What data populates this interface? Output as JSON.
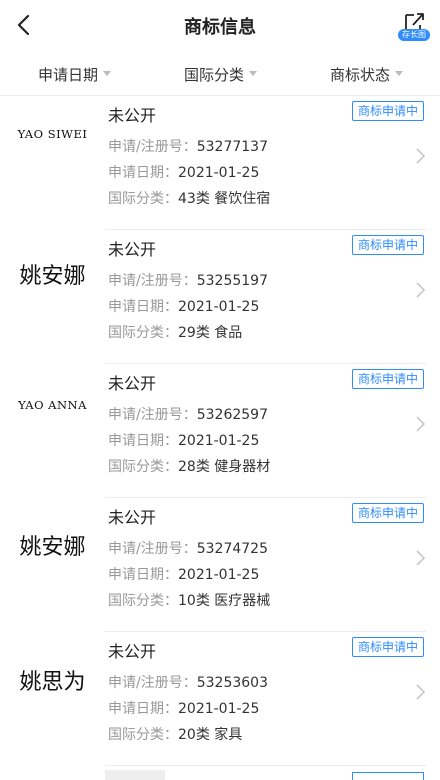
{
  "header": {
    "title": "商标信息",
    "share_badge": "存长图",
    "back_icon": "chevron-left-icon",
    "share_icon": "share-export-icon"
  },
  "filters": [
    {
      "label": "申请日期"
    },
    {
      "label": "国际分类"
    },
    {
      "label": "商标状态"
    }
  ],
  "labels": {
    "reg_no": "申请/注册号：",
    "apply_date": "申请日期：",
    "intl_class": "国际分类："
  },
  "colors": {
    "accent": "#2f8cff"
  },
  "items": [
    {
      "logo_text": "YAO SIWEI",
      "logo_style": "latin",
      "name": "未公开",
      "status": "商标申请中",
      "reg_no": "53277137",
      "apply_date": "2021-01-25",
      "intl_class": "43类 餐饮住宿"
    },
    {
      "logo_text": "姚安娜",
      "logo_style": "cjk",
      "name": "未公开",
      "status": "商标申请中",
      "reg_no": "53255197",
      "apply_date": "2021-01-25",
      "intl_class": "29类 食品"
    },
    {
      "logo_text": "YAO ANNA",
      "logo_style": "latin",
      "name": "未公开",
      "status": "商标申请中",
      "reg_no": "53262597",
      "apply_date": "2021-01-25",
      "intl_class": "28类 健身器材"
    },
    {
      "logo_text": "姚安娜",
      "logo_style": "cjk",
      "name": "未公开",
      "status": "商标申请中",
      "reg_no": "53274725",
      "apply_date": "2021-01-25",
      "intl_class": "10类 医疗器械"
    },
    {
      "logo_text": "姚思为",
      "logo_style": "cjk",
      "name": "未公开",
      "status": "商标申请中",
      "reg_no": "53253603",
      "apply_date": "2021-01-25",
      "intl_class": "20类 家具"
    }
  ]
}
